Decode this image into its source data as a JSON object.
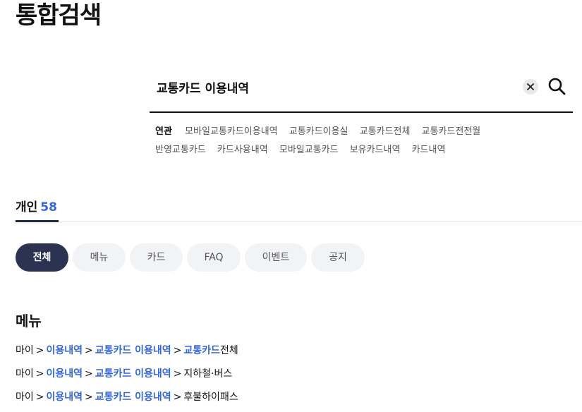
{
  "page": {
    "title": "통합검색"
  },
  "search": {
    "query": "교통카드 이용내역"
  },
  "related": {
    "label": "연관",
    "keywords": [
      "모바일교통카드이용내역",
      "교통카드이용실",
      "교통카드전체",
      "교통카드전전월",
      "반영교통카드",
      "카드사용내역",
      "모바일교통카드",
      "보유카드내역",
      "카드내역"
    ]
  },
  "tabs": [
    {
      "label": "개인",
      "count": "58"
    }
  ],
  "filters": [
    "전체",
    "메뉴",
    "카드",
    "FAQ",
    "이벤트",
    "공지"
  ],
  "section": {
    "title": "메뉴"
  },
  "menu_paths": [
    {
      "root": "마이",
      "link1": "이용내역",
      "link2": "교통카드 이용내역",
      "last_link": "교통카드",
      "last_text": "전체"
    },
    {
      "root": "마이",
      "link1": "이용내역",
      "link2": "교통카드 이용내역",
      "last_link": "",
      "last_text": "지하철·버스"
    },
    {
      "root": "마이",
      "link1": "이용내역",
      "link2": "교통카드 이용내역",
      "last_link": "",
      "last_text": "후불하이패스"
    }
  ],
  "separator": ">",
  "icons": {
    "clear": "close-icon",
    "search": "search-icon"
  },
  "colors": {
    "accent": "#3366dd",
    "active_chip": "#2c3252",
    "chip_bg": "#f2f3f5"
  }
}
